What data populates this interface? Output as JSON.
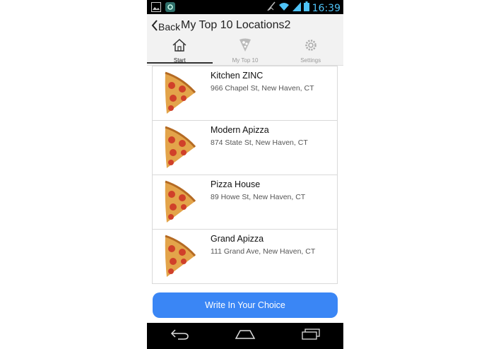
{
  "status_bar": {
    "time": "16:39",
    "icons": [
      "gallery-icon",
      "app-icon",
      "signal-off-icon",
      "wifi-icon",
      "cell-signal-icon",
      "battery-icon"
    ]
  },
  "header": {
    "back_label": "Back",
    "title": "My Top 10 Locations2"
  },
  "tabs": [
    {
      "label": "Start",
      "icon": "home-icon",
      "active": true
    },
    {
      "label": "My Top 10",
      "icon": "pizza-icon",
      "active": false
    },
    {
      "label": "Settings",
      "icon": "gear-icon",
      "active": false
    }
  ],
  "locations": [
    {
      "name": "Kitchen ZINC",
      "address": "966 Chapel St, New Haven, CT"
    },
    {
      "name": "Modern Apizza",
      "address": "874 State St, New Haven, CT"
    },
    {
      "name": "Pizza House",
      "address": "89 Howe St, New Haven, CT"
    },
    {
      "name": "Grand Apizza",
      "address": "111 Grand Ave, New Haven, CT"
    }
  ],
  "write_in_button": "Write In Your Choice",
  "nav_bar": [
    "back-icon",
    "home-icon",
    "recents-icon"
  ],
  "colors": {
    "accent": "#3a86f5",
    "status_time": "#4fc3f7"
  }
}
